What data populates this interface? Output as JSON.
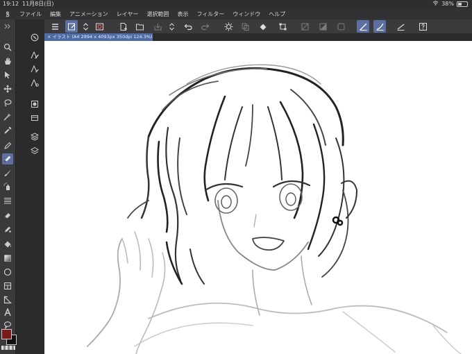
{
  "status": {
    "time": "19:12",
    "date": "11月8日(日)",
    "battery": "38%"
  },
  "menu": {
    "items": [
      "ファイル",
      "編集",
      "アニメーション",
      "レイヤー",
      "選択範囲",
      "表示",
      "フィルター",
      "ウィンドウ",
      "ヘルプ"
    ]
  },
  "document": {
    "tab_label": "× イラスト (A4 2894 x 4093px 350dpi 124.3%)"
  },
  "colors": {
    "accent": "#5b6fa0",
    "foreground": "#7a1b1b",
    "background": "#111111"
  }
}
